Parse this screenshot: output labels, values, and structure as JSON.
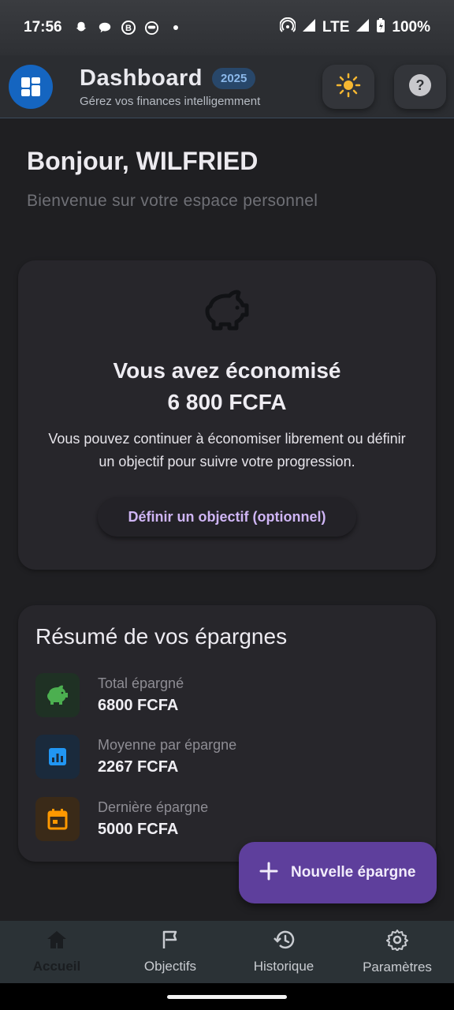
{
  "status_bar": {
    "time": "17:56",
    "network": "LTE",
    "battery": "100%",
    "left_icons": [
      "snapchat-icon",
      "chat-bubble-icon",
      "b-circle-icon",
      "robot-icon",
      "dot-icon"
    ],
    "right_icons": [
      "hotspot-icon",
      "signal-icon",
      "wifi-signal-icon",
      "battery-charging-icon"
    ]
  },
  "app_bar": {
    "title": "Dashboard",
    "year_badge": "2025",
    "subtitle": "Gérez vos finances intelligemment",
    "theme_icon": "sun-icon",
    "help_icon": "help-icon"
  },
  "greeting": {
    "title": "Bonjour, WILFRIED",
    "subtitle": "Bienvenue sur votre espace personnel"
  },
  "savings_card": {
    "title": "Vous avez économisé",
    "amount": "6 800 FCFA",
    "description": "Vous pouvez continuer à économiser librement ou définir un objectif pour suivre votre progression.",
    "goal_button": "Définir un objectif (optionnel)"
  },
  "summary": {
    "title": "Résumé de vos épargnes",
    "stats": [
      {
        "label": "Total épargné",
        "value": "6800 FCFA",
        "icon": "piggy-bank-icon",
        "color": "#4caf50"
      },
      {
        "label": "Moyenne par épargne",
        "value": "2267 FCFA",
        "icon": "bar-chart-icon",
        "color": "#2196f3"
      },
      {
        "label": "Dernière épargne",
        "value": "5000 FCFA",
        "icon": "calendar-icon",
        "color": "#ff9800"
      }
    ]
  },
  "fab": {
    "label": "Nouvelle épargne",
    "icon": "plus-icon"
  },
  "bottom_nav": {
    "items": [
      {
        "label": "Accueil",
        "icon": "home-icon",
        "active": true
      },
      {
        "label": "Objectifs",
        "icon": "flag-icon",
        "active": false
      },
      {
        "label": "Historique",
        "icon": "history-icon",
        "active": false
      },
      {
        "label": "Paramètres",
        "icon": "settings-icon",
        "active": false
      }
    ]
  },
  "colors": {
    "background": "#1f1f22",
    "accent": "#1565c0",
    "fab": "#5e3f9c",
    "link": "#cfb5f5"
  }
}
